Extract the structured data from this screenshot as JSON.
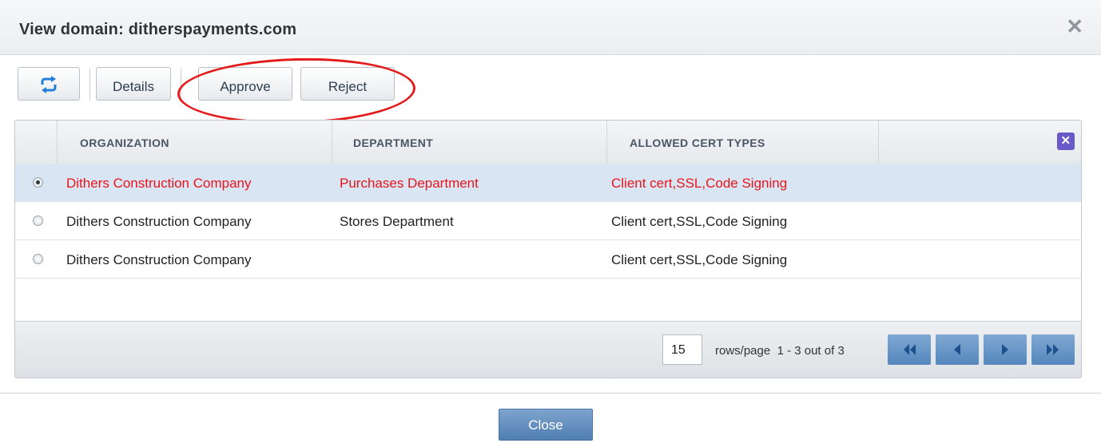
{
  "dialog": {
    "title": "View domain: ditherspayments.com",
    "close_glyph": "✕"
  },
  "toolbar": {
    "refresh_icon": "refresh-icon",
    "details_label": "Details",
    "approve_label": "Approve",
    "reject_label": "Reject"
  },
  "table": {
    "columns": [
      "ORGANIZATION",
      "DEPARTMENT",
      "ALLOWED CERT TYPES"
    ],
    "rows": [
      {
        "organization": "Dithers Construction Company",
        "department": "Purchases Department",
        "cert_types": "Client cert,SSL,Code Signing",
        "selected": true
      },
      {
        "organization": "Dithers Construction Company",
        "department": "Stores Department",
        "cert_types": "Client cert,SSL,Code Signing",
        "selected": false
      },
      {
        "organization": "Dithers Construction Company",
        "department": "",
        "cert_types": "Client cert,SSL,Code Signing",
        "selected": false
      }
    ],
    "selected_color": "#e8141c"
  },
  "pager": {
    "rows_per_page": "15",
    "rows_label": "rows/page",
    "range_text": "1 - 3 out of 3"
  },
  "footer": {
    "close_label": "Close"
  }
}
